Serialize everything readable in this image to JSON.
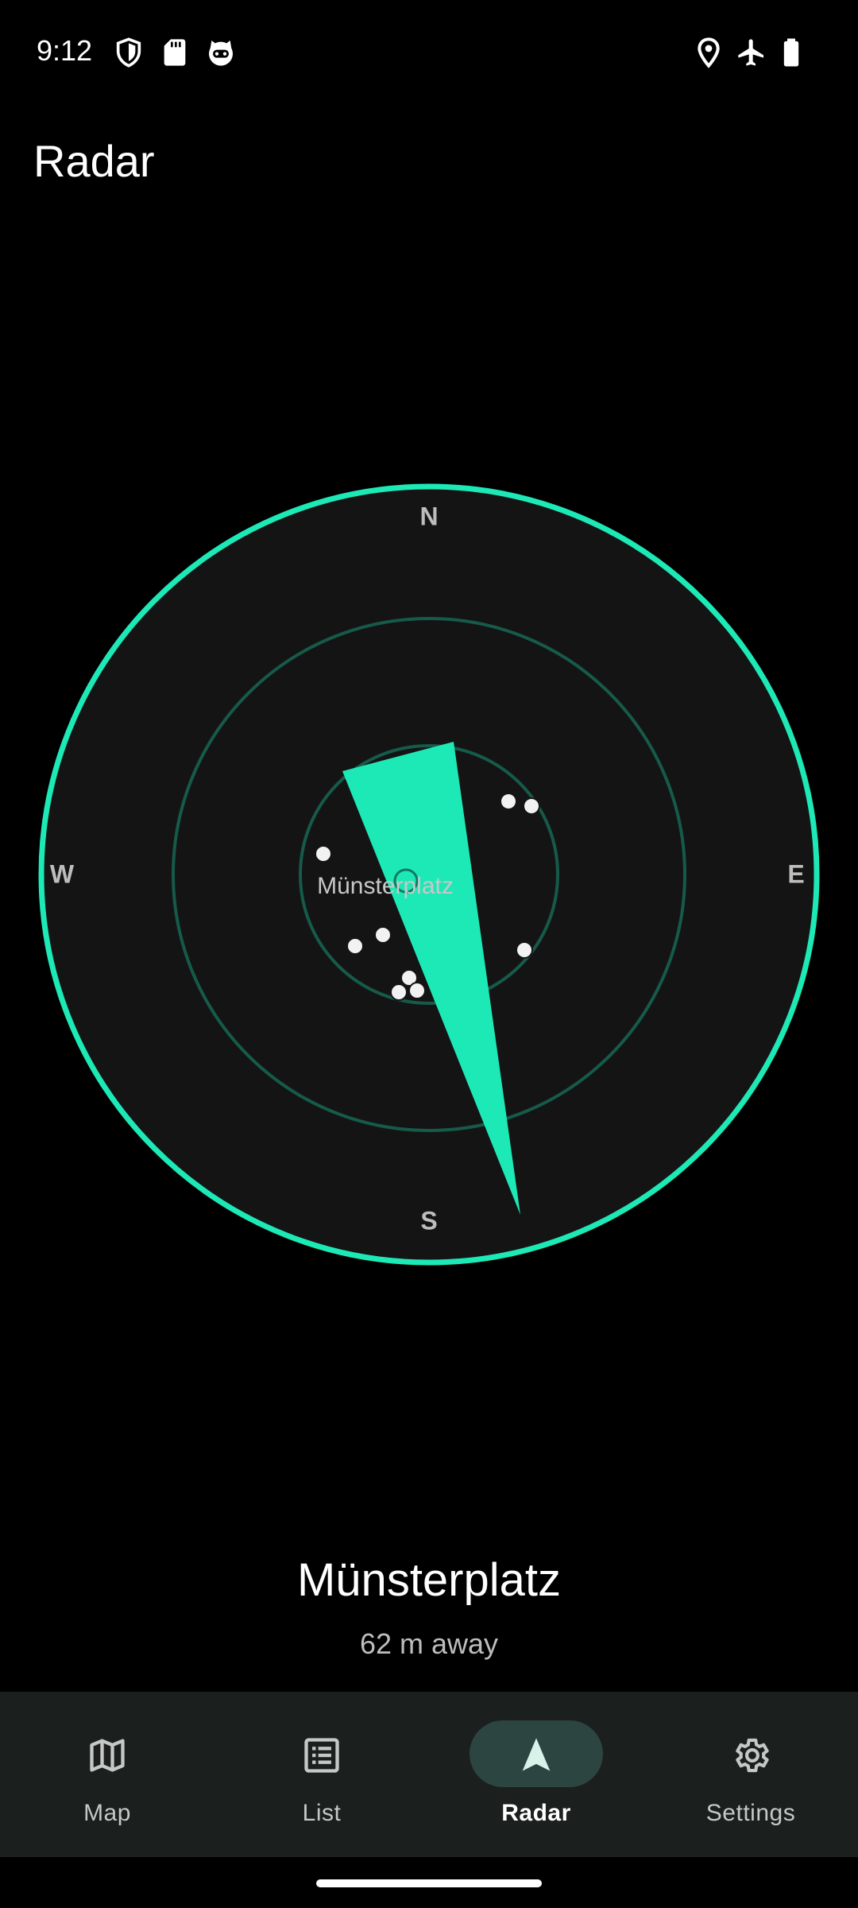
{
  "status_bar": {
    "time": "9:12",
    "icons_left": [
      "shield-icon",
      "sd-card-icon",
      "cat-face-icon"
    ],
    "icons_right": [
      "location-icon",
      "airplane-icon",
      "battery-icon"
    ]
  },
  "app_bar": {
    "title": "Radar"
  },
  "radar": {
    "compass": {
      "north": "N",
      "east": "E",
      "south": "S",
      "west": "W"
    },
    "center_label": "Münsterplatz",
    "heading_degrees": 168,
    "accent_color": "#1de9b6",
    "ring_color": "#165a4a",
    "background_color": "#141414"
  },
  "target": {
    "name": "Münsterplatz",
    "distance": "62 m away"
  },
  "bottom_nav": {
    "items": [
      {
        "label": "Map",
        "icon": "map-icon",
        "active": false
      },
      {
        "label": "List",
        "icon": "list-icon",
        "active": false
      },
      {
        "label": "Radar",
        "icon": "navigation-arrow-icon",
        "active": true
      },
      {
        "label": "Settings",
        "icon": "gear-icon",
        "active": false
      }
    ]
  }
}
